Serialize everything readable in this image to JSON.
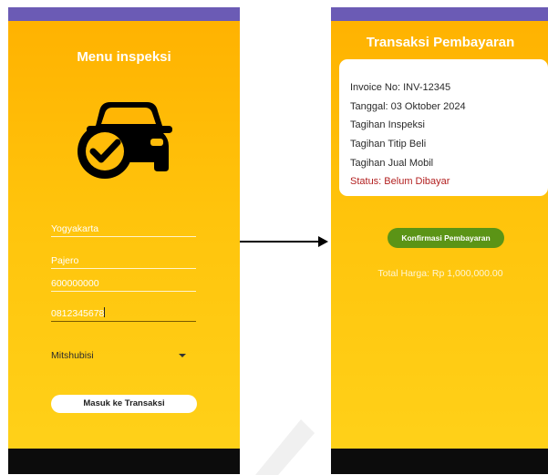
{
  "left_screen": {
    "title": "Menu inspeksi",
    "car_icon": "car-check-icon",
    "fields": {
      "city": "Yogyakarta",
      "model": "Pajero",
      "price": "600000000",
      "phone": "0812345678"
    },
    "dropdown": {
      "selected": "Mitshubisi",
      "icon": "chevron-down-icon"
    },
    "button_label": "Masuk ke Transaksi"
  },
  "right_screen": {
    "title": "Transaksi Pembayaran",
    "card_lines": [
      "Invoice No: INV-12345",
      "Tanggal: 03 Oktober 2024",
      "Tagihan Inspeksi",
      "Tagihan Titip Beli",
      "Tagihan Jual Mobil",
      "Status: Belum Dibayar"
    ],
    "button_label": "Konfirmasi Pembayaran",
    "total": "Total Harga: Rp 1,000,000.00"
  },
  "colors": {
    "status_bar": "#6b5bb5",
    "background_top": "#ffb100",
    "background_bottom": "#ffd21a",
    "confirm_button": "#5b9416",
    "status_text": "#b21f1f",
    "nav_bar": "#0c0c0c"
  },
  "connector": "arrow-right"
}
